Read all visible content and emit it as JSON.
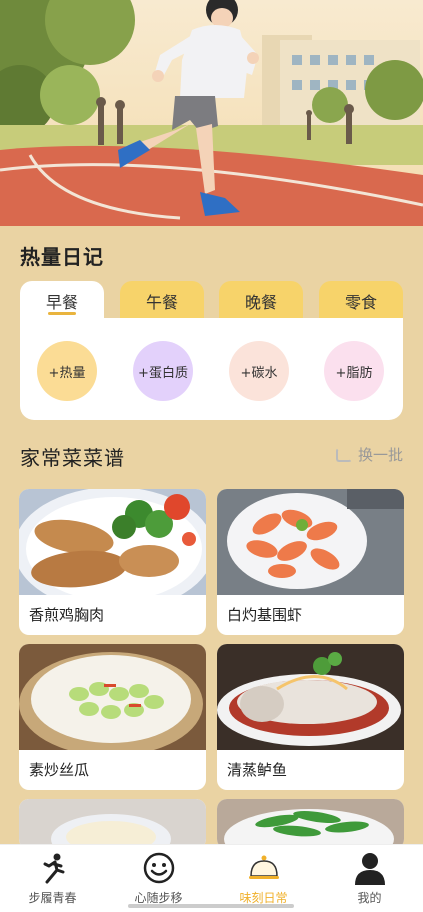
{
  "hero": {
    "alt_icon": "runner-illustration"
  },
  "calorie_diary": {
    "title": "热量日记",
    "tabs": [
      {
        "label": "早餐",
        "active": true
      },
      {
        "label": "午餐",
        "active": false
      },
      {
        "label": "晚餐",
        "active": false
      },
      {
        "label": "零食",
        "active": false
      }
    ],
    "nutrients": [
      {
        "label": "+热量",
        "color": "#fbdc95"
      },
      {
        "label": "+蛋白质",
        "color": "#e3d1fb"
      },
      {
        "label": "+碳水",
        "color": "#fbe3da"
      },
      {
        "label": "+脂肪",
        "color": "#fbe0ee"
      }
    ]
  },
  "recipes": {
    "title": "家常菜菜谱",
    "refresh_label": "换一批",
    "items": [
      {
        "name": "香煎鸡胸肉"
      },
      {
        "name": "白灼基围虾"
      },
      {
        "name": "素炒丝瓜"
      },
      {
        "name": "清蒸鲈鱼"
      }
    ]
  },
  "bottom_nav": {
    "items": [
      {
        "label": "步履青春",
        "icon": "running-person-icon"
      },
      {
        "label": "心随步移",
        "icon": "smiley-face-icon"
      },
      {
        "label": "味刻日常",
        "icon": "food-cloche-icon",
        "active": true
      },
      {
        "label": "我的",
        "icon": "user-profile-icon"
      }
    ]
  },
  "colors": {
    "background": "#ead3a3",
    "accent": "#f0b02a",
    "tab": "#f7d36a"
  }
}
